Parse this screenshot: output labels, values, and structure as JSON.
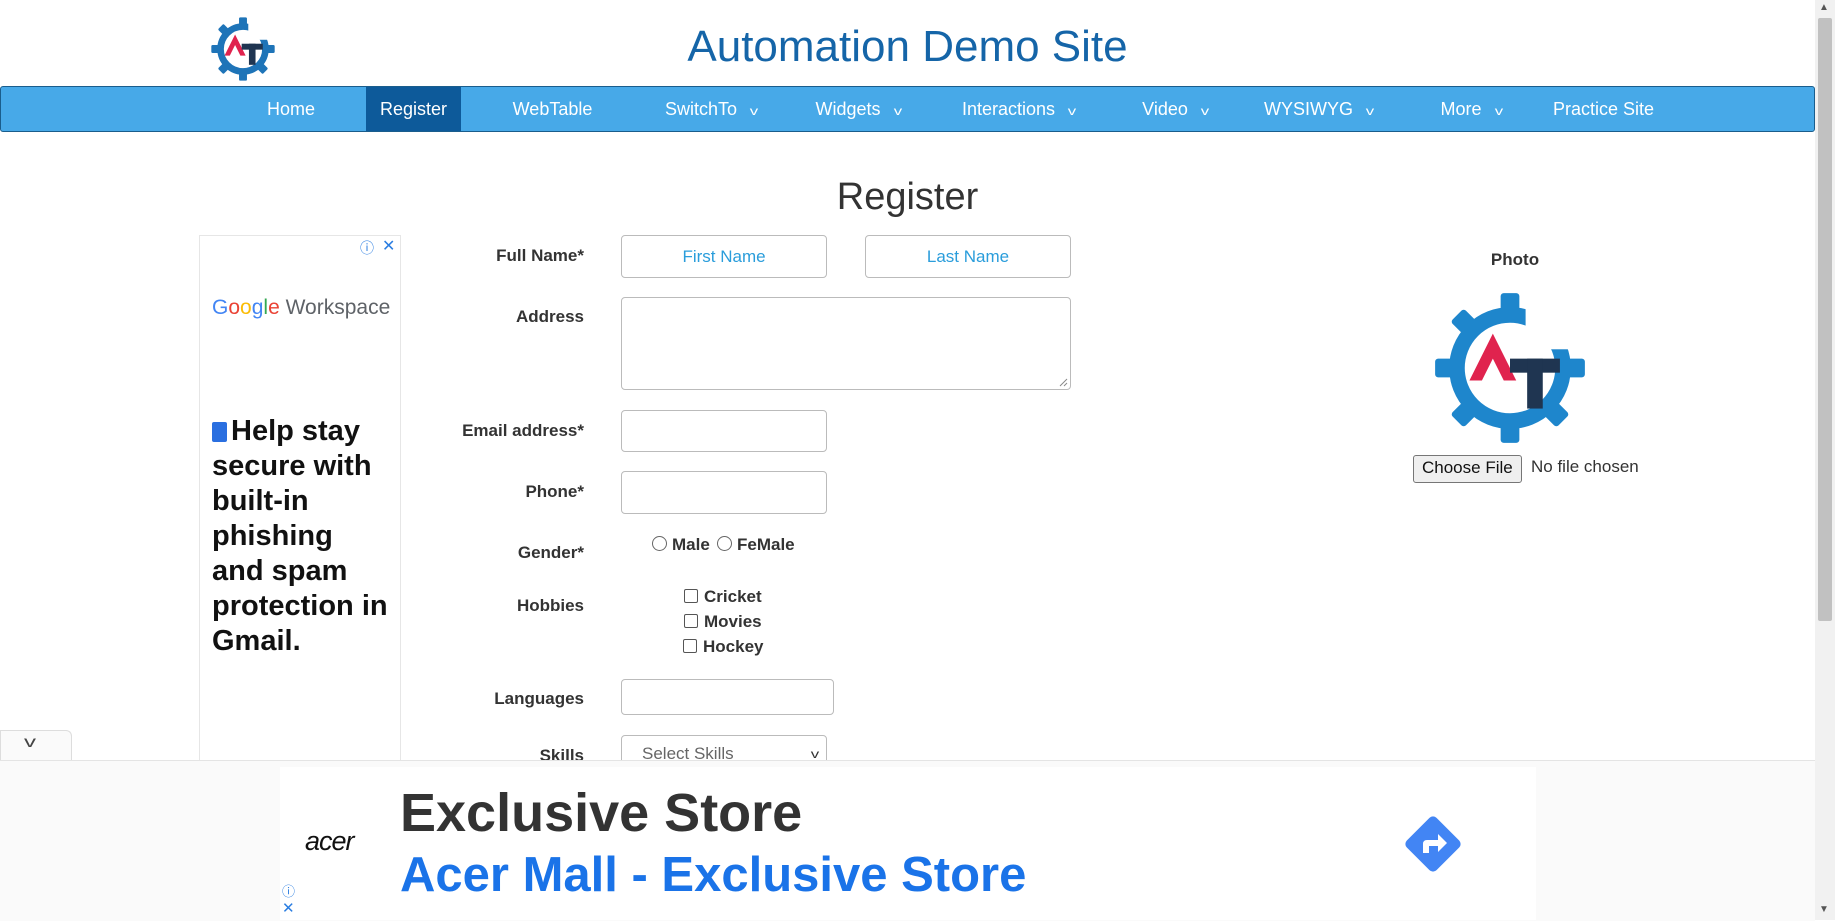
{
  "header": {
    "title": "Automation Demo Site",
    "logo_icon": "gear-at-logo-icon"
  },
  "nav": {
    "items": [
      {
        "label": "Home",
        "dropdown": false
      },
      {
        "label": "Register",
        "dropdown": false,
        "active": true
      },
      {
        "label": "WebTable",
        "dropdown": false
      },
      {
        "label": "SwitchTo",
        "dropdown": true
      },
      {
        "label": "Widgets",
        "dropdown": true
      },
      {
        "label": "Interactions",
        "dropdown": true
      },
      {
        "label": "Video",
        "dropdown": true
      },
      {
        "label": "WYSIWYG",
        "dropdown": true
      },
      {
        "label": "More",
        "dropdown": true
      },
      {
        "label": "Practice Site",
        "dropdown": false
      }
    ]
  },
  "page": {
    "heading": "Register"
  },
  "form": {
    "full_name_label": "Full Name*",
    "first_name_placeholder": "First Name",
    "last_name_placeholder": "Last Name",
    "address_label": "Address",
    "email_label": "Email address*",
    "phone_label": "Phone*",
    "gender_label": "Gender*",
    "gender_options": [
      "Male",
      "FeMale"
    ],
    "hobbies_label": "Hobbies",
    "hobbies_options": [
      "Cricket",
      "Movies",
      "Hockey"
    ],
    "languages_label": "Languages",
    "skills_label": "Skills",
    "skills_placeholder": "Select Skills"
  },
  "photo": {
    "label": "Photo",
    "choose_file_label": "Choose File",
    "no_file_text": "No file chosen"
  },
  "side_ad": {
    "brand_google": [
      "G",
      "o",
      "o",
      "g",
      "l",
      "e"
    ],
    "brand_workspace": "Workspace",
    "headline": "Help stay secure with built-in phishing and spam protection in Gmail."
  },
  "bottom_ad": {
    "brand": "acer",
    "title": "Exclusive Store",
    "subtitle": "Acer Mall - Exclusive Store"
  },
  "colors": {
    "nav_bg": "#47a9e8",
    "nav_active": "#0d5a9a",
    "title_blue": "#1565a8",
    "placeholder_blue": "#2a9ddb",
    "ad_link_blue": "#1a73e8"
  }
}
